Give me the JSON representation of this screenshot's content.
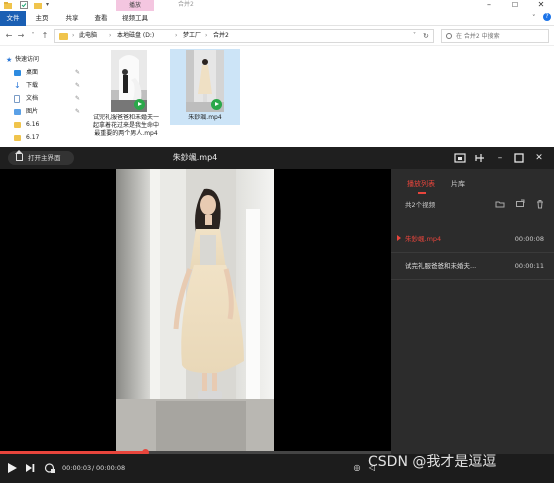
{
  "explorer": {
    "window_title": "合并2",
    "context_tab": "播放",
    "tabs": [
      "文件",
      "主页",
      "共享",
      "查看",
      "视频工具"
    ],
    "window_controls": {
      "minimize": "–",
      "maximize": "☐",
      "close": "✕"
    },
    "breadcrumb": [
      "此电脑",
      "本地磁盘 (D:)",
      "梦工厂",
      "合并2"
    ],
    "search_placeholder": "在 合并2 中搜索",
    "nav_items": [
      {
        "label": "快速访问",
        "icon": "star-icon",
        "pinned": false
      },
      {
        "label": "桌面",
        "icon": "desktop-icon",
        "pinned": true
      },
      {
        "label": "下载",
        "icon": "download-icon",
        "pinned": true
      },
      {
        "label": "文档",
        "icon": "document-icon",
        "pinned": true
      },
      {
        "label": "图片",
        "icon": "picture-icon",
        "pinned": true
      },
      {
        "label": "6.16",
        "icon": "folder-icon",
        "pinned": false
      },
      {
        "label": "6.17",
        "icon": "folder-icon",
        "pinned": false
      }
    ],
    "files": [
      {
        "name": "试完礼服爸爸和未婚夫一起拿着花过来是我生命中最重要的两个男人.mp4"
      },
      {
        "name": "朱鈔颯.mp4"
      }
    ]
  },
  "player": {
    "home_button": "打开主界面",
    "title": "朱鈔颯.mp4",
    "tabs": {
      "playlist": "播放列表",
      "library": "片库"
    },
    "video_count": "共2个视频",
    "playlist": [
      {
        "title": "朱鈔颯.mp4",
        "duration": "00:00:08",
        "active": true
      },
      {
        "title": "试完礼服爸爸和未婚夫...",
        "duration": "00:00:11",
        "active": false
      }
    ],
    "time_current": "00:00:03",
    "time_separator": "/",
    "time_total": "00:00:08",
    "progress": 0.37,
    "colors": {
      "accent": "#e8453c",
      "background": "#232323",
      "panel": "#2c2c2c"
    }
  },
  "watermark": "CSDN @我才是逗逗"
}
